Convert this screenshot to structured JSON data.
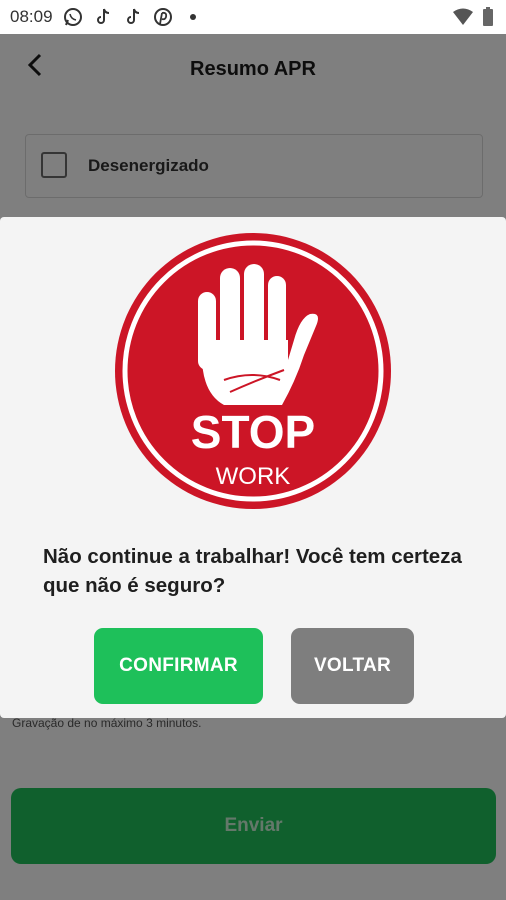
{
  "status_bar": {
    "time": "08:09",
    "icons": [
      "whatsapp-icon",
      "tiktok-icon",
      "tiktok-icon",
      "pinterest-icon",
      "dot-icon"
    ],
    "right_icons": [
      "wifi-icon",
      "battery-icon"
    ]
  },
  "app_bar": {
    "title": "Resumo APR",
    "back_icon": "arrow-back-icon"
  },
  "checklist": {
    "item_label": "Desenergizado",
    "checked": false
  },
  "recording_note": "Gravação de no máximo 3 minutos.",
  "send_button": {
    "label": "Enviar",
    "color": "#21c05a"
  },
  "dialog": {
    "sign": {
      "line1": "STOP",
      "line2": "WORK",
      "color": "#cc1526"
    },
    "message": "Não continue a trabalhar! Você tem certeza que não é seguro?",
    "confirm_label": "CONFIRMAR",
    "back_label": "VOLTAR",
    "confirm_color": "#1ec05a",
    "back_color": "#7e7e7e"
  }
}
